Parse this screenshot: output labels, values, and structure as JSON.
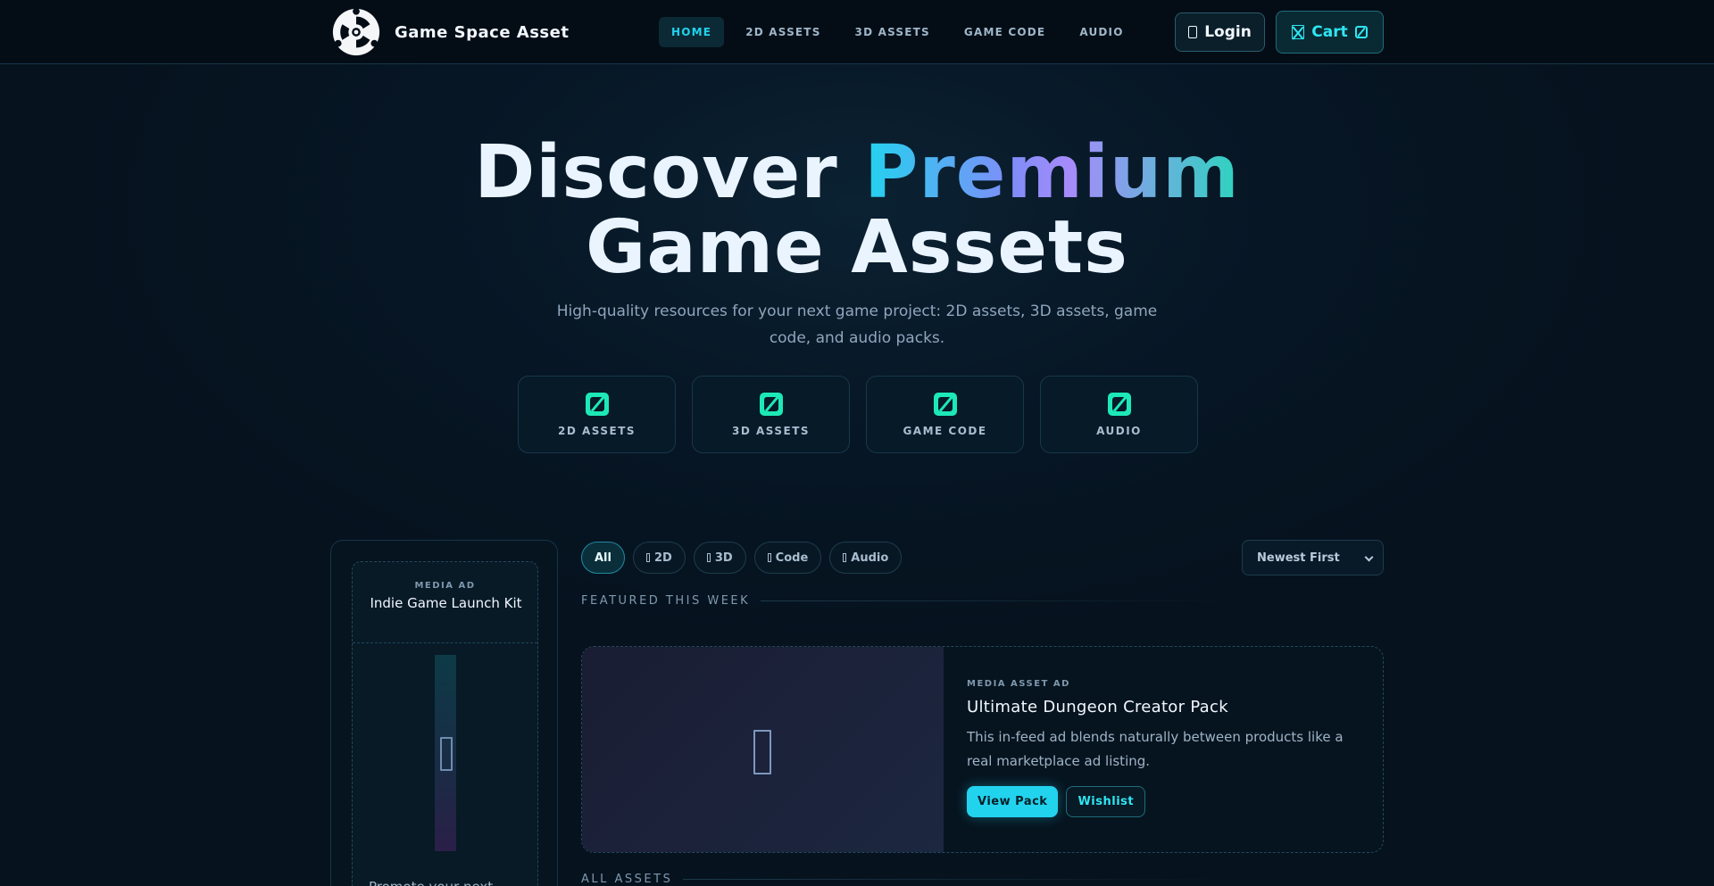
{
  "brand": {
    "name": "Game Space Asset",
    "logo_icon": "biohazard-logo-icon"
  },
  "nav": {
    "links": [
      {
        "label": "HOME",
        "active": true
      },
      {
        "label": "2D ASSETS",
        "active": false
      },
      {
        "label": "3D ASSETS",
        "active": false
      },
      {
        "label": "GAME CODE",
        "active": false
      },
      {
        "label": "AUDIO",
        "active": false
      }
    ],
    "login_label": "Login",
    "cart_label": "Cart"
  },
  "hero": {
    "title_part1": "Discover ",
    "title_highlight": "Premium",
    "title_line2": "Game Assets",
    "subtitle": "High-quality resources for your next game project: 2D assets, 3D assets, game code, and audio packs."
  },
  "categories": [
    {
      "label": "2D ASSETS"
    },
    {
      "label": "3D ASSETS"
    },
    {
      "label": "GAME CODE"
    },
    {
      "label": "AUDIO"
    }
  ],
  "sidebar_ad": {
    "tag": "MEDIA AD",
    "title": "Indie Game Launch Kit",
    "text": "Promote your next"
  },
  "filters": {
    "chips": [
      {
        "label": "All",
        "active": true
      },
      {
        "label": "2D",
        "active": false
      },
      {
        "label": "3D",
        "active": false
      },
      {
        "label": "Code",
        "active": false
      },
      {
        "label": "Audio",
        "active": false
      }
    ],
    "sort_selected": "Newest First"
  },
  "sections": {
    "featured": "FEATURED THIS WEEK",
    "all": "ALL ASSETS"
  },
  "featured_ad": {
    "tag": "MEDIA ASSET AD",
    "title": "Ultimate Dungeon Creator Pack",
    "description": "This in-feed ad blends naturally between products like a real marketplace ad listing.",
    "primary_label": "View Pack",
    "secondary_label": "Wishlist"
  },
  "colors": {
    "accent": "#22d3ee",
    "accent_green": "#1de9b6",
    "background": "#071726"
  }
}
